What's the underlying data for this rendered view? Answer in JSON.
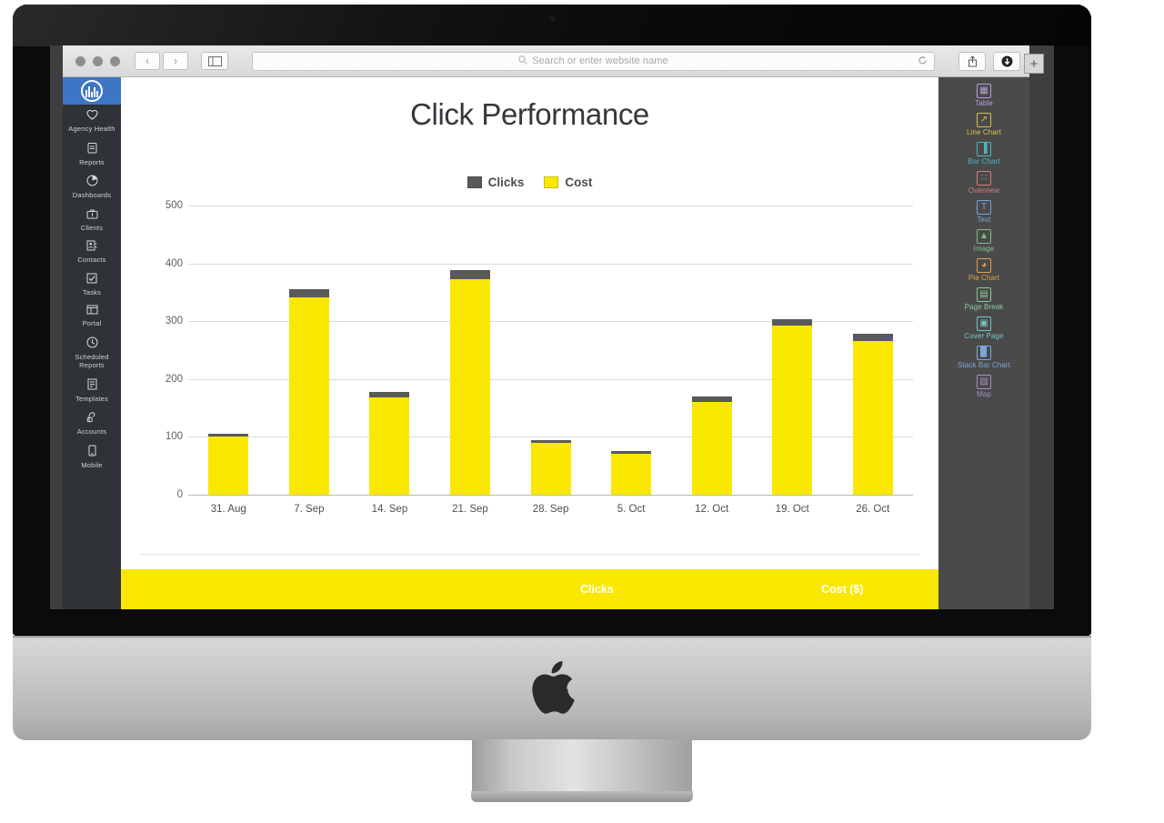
{
  "browser": {
    "address_placeholder": "Search or enter website name",
    "search_icon": "search-icon",
    "reload_icon": "reload-icon",
    "back_icon": "‹",
    "forward_icon": "›",
    "sidebar_toggle_icon": "sidebar-toggle-icon",
    "share_icon": "share-icon",
    "downloads_icon": "downloads-icon",
    "newtab_label": "+"
  },
  "sidebar": {
    "logo_name": "app-logo",
    "items": [
      {
        "icon": "♡",
        "label": "Agency Health"
      },
      {
        "icon": "ὌB",
        "label": "Reports"
      },
      {
        "icon": "◔",
        "label": "Dashboards"
      },
      {
        "icon": "ὋC",
        "label": "Clients"
      },
      {
        "icon": "▤",
        "label": "Contacts"
      },
      {
        "icon": "☑",
        "label": "Tasks"
      },
      {
        "icon": "▦",
        "label": "Portal"
      },
      {
        "icon": "◴",
        "label": "Scheduled Reports"
      },
      {
        "icon": "▧",
        "label": "Templates"
      },
      {
        "icon": "☝",
        "label": "Accounts"
      },
      {
        "icon": "▯",
        "label": "Mobile"
      }
    ]
  },
  "widgets": {
    "items": [
      {
        "label": "Table",
        "color": "#b3a0d8",
        "glyph": "▦"
      },
      {
        "label": "Line Chart",
        "color": "#d6c24a",
        "glyph": "↗"
      },
      {
        "label": "Bar Chart",
        "color": "#4fb6c0",
        "glyph": "▐"
      },
      {
        "label": "Overview",
        "color": "#d97b7b",
        "glyph": "∷"
      },
      {
        "label": "Text",
        "color": "#6fa8dc",
        "glyph": "T"
      },
      {
        "label": "Image",
        "color": "#7fc08a",
        "glyph": "▲"
      },
      {
        "label": "Pie Chart",
        "color": "#e0a24b",
        "glyph": "◕"
      },
      {
        "label": "Page Break",
        "color": "#8dc89a",
        "glyph": "▤"
      },
      {
        "label": "Cover Page",
        "color": "#76c4c9",
        "glyph": "▣"
      },
      {
        "label": "Stack Bar Chart",
        "color": "#7da7d9",
        "glyph": "▉"
      },
      {
        "label": "Map",
        "color": "#a48ccd",
        "glyph": "▨"
      }
    ]
  },
  "report": {
    "title": "Click Performance",
    "footer_left_label": "Clicks",
    "footer_right_label": "Cost ($)",
    "footer_bg": "#fae800"
  },
  "chart_data": {
    "type": "bar",
    "stacked": true,
    "title": "Click Performance",
    "xlabel": "",
    "ylabel": "",
    "ylim": [
      0,
      500
    ],
    "yticks": [
      0,
      100,
      200,
      300,
      400,
      500
    ],
    "grid": true,
    "legend_position": "top-center",
    "categories": [
      "31. Aug",
      "7. Sep",
      "14. Sep",
      "21. Sep",
      "28. Sep",
      "5. Oct",
      "12. Oct",
      "19. Oct",
      "26. Oct"
    ],
    "series": [
      {
        "name": "Cost",
        "color": "#fae800",
        "values": [
          100,
          342,
          168,
          373,
          90,
          71,
          160,
          292,
          266
        ]
      },
      {
        "name": "Clicks",
        "color": "#59595b",
        "values": [
          5,
          14,
          10,
          15,
          5,
          5,
          10,
          12,
          12
        ]
      }
    ]
  }
}
